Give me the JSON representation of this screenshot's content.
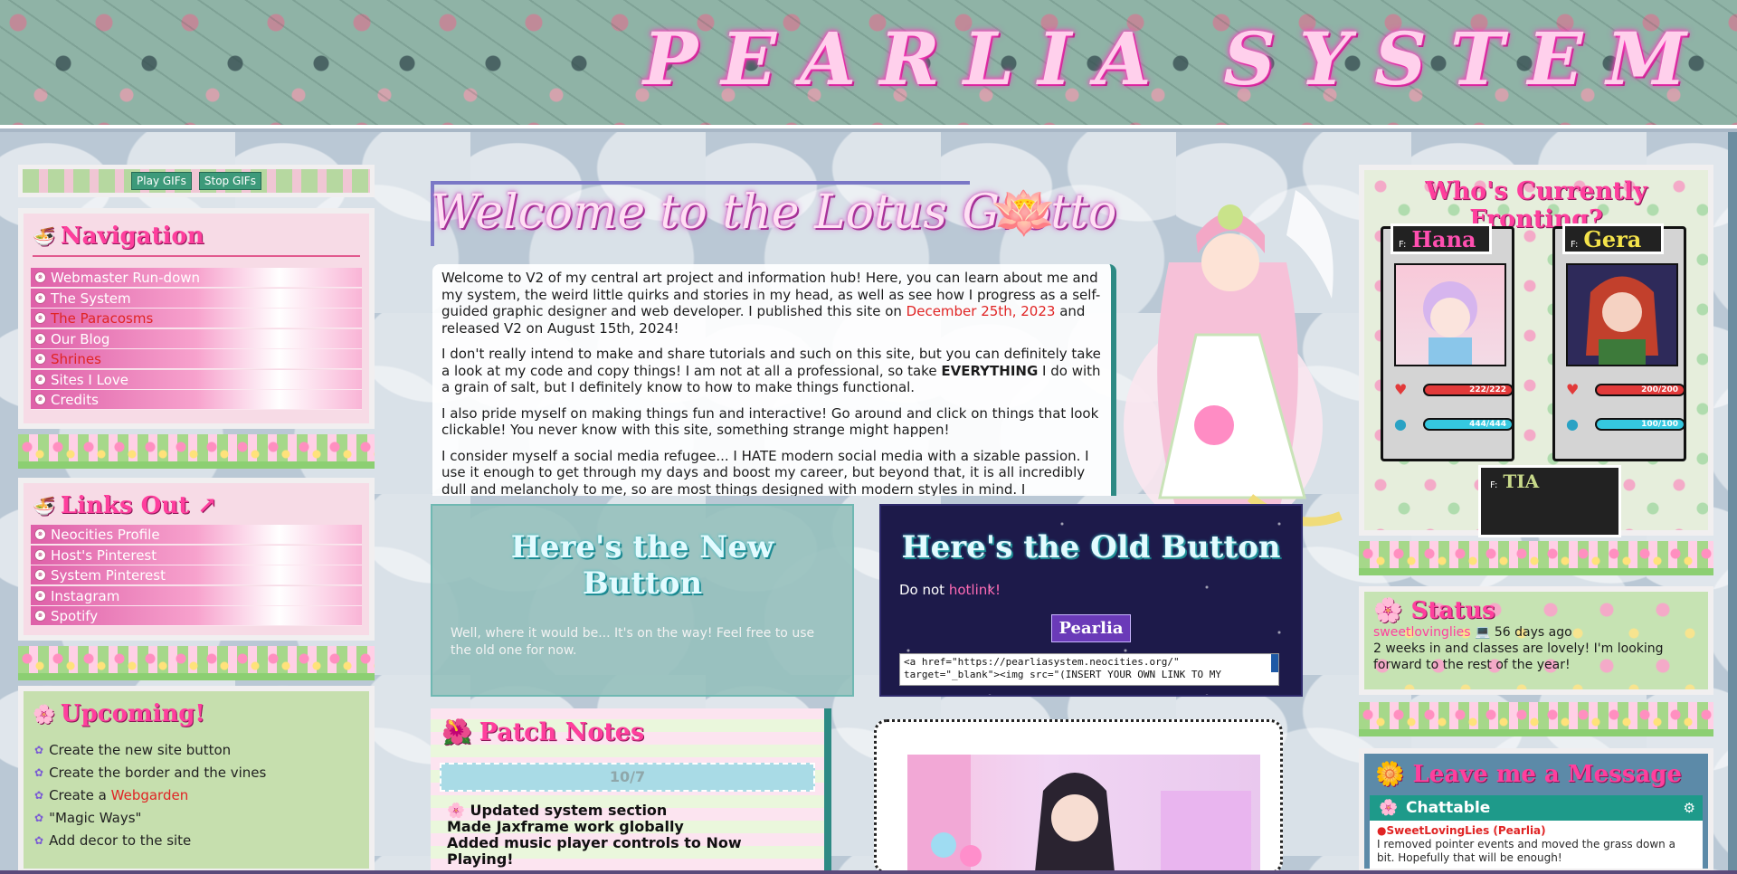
{
  "header": {
    "title": "PEARLIA SYSTEM"
  },
  "gif_controls": {
    "play": "Play GIFs",
    "stop": "Stop GIFs"
  },
  "navigation": {
    "title": "Navigation",
    "items": [
      {
        "label": "Webmaster Run-down",
        "style": "normal"
      },
      {
        "label": "The System",
        "style": "normal"
      },
      {
        "label": "The Paracosms",
        "style": "red"
      },
      {
        "label": "Our Blog",
        "style": "normal"
      },
      {
        "label": "Shrines",
        "style": "red"
      },
      {
        "label": "Sites I Love",
        "style": "normal"
      },
      {
        "label": "Credits",
        "style": "normal"
      }
    ]
  },
  "links_out": {
    "title": "Links Out ↗",
    "items": [
      {
        "label": "Neocities Profile"
      },
      {
        "label": "Host's Pinterest"
      },
      {
        "label": "System Pinterest"
      },
      {
        "label": "Instagram"
      },
      {
        "label": "Spotify"
      }
    ]
  },
  "upcoming": {
    "title": "Upcoming!",
    "items": [
      {
        "before": "Create the new site button",
        "link": "",
        "after": ""
      },
      {
        "before": "Create the border and the vines",
        "link": "",
        "after": ""
      },
      {
        "before": "Create a ",
        "link": "Webgarden",
        "after": ""
      },
      {
        "before": "\"Magic Ways\"",
        "link": "",
        "after": ""
      },
      {
        "before": "Add decor to the site",
        "link": "",
        "after": ""
      }
    ]
  },
  "welcome": {
    "title": "Welcome to the Lotus Grotto",
    "p1_a": "Welcome to V2 of my central art project and information hub! Here, you can learn about me and my system, the weird little quirks and stories in my head, as well as see how I progress as a self-guided graphic designer and web developer. I published this site on ",
    "p1_date": "December 25th, 2023",
    "p1_b": " and released V2 on August 15th, 2024!",
    "p2_a": "I don't really intend to make and share tutorials and such on this site, but you can definitely take a look at my code and copy things! I am not at all a professional, so take ",
    "p2_caps": "EVERYTHING",
    "p2_b": " I do with a grain of salt, but I definitely know to how to make things functional.",
    "p3": "I also pride myself on making things fun and interactive! Go around and click on things that look clickable! You never know with this site, something strange might happen!",
    "p4": "I consider myself a social media refugee... I HATE modern social media with a sizable passion. I use it enough to get through my days and boost my career, but beyond that, it is all incredibly dull and melancholy to me, so are most things designed with modern styles in mind. I"
  },
  "new_button": {
    "title": "Here's the New Button",
    "text": "Well, where it would be... It's on the way! Feel free to use the old one for now."
  },
  "old_button": {
    "title": "Here's the Old Button",
    "hotlink_prefix": "Do not ",
    "hotlink_link": "hotlink!",
    "badge": "Pearlia",
    "code": "<a href=\"https://pearliasystem.neocities.org/\" target=\"_blank\"><img src=\"(INSERT YOUR OWN LINK TO MY"
  },
  "patch_notes": {
    "title": "Patch Notes",
    "date": "10/7",
    "line1": "Updated system section",
    "line2": "Made Jaxframe work globally",
    "line3": "Added music player controls to Now Playing!"
  },
  "fronting": {
    "title": "Who's Currently Fronting?",
    "cards": [
      {
        "prefix": "F:",
        "name": "Hana",
        "hp": "222/222",
        "mp": "444/444",
        "color": "#ff4fb0"
      },
      {
        "prefix": "F:",
        "name": "Gera",
        "hp": "200/200",
        "mp": "100/100",
        "color": "#f4e34a"
      }
    ],
    "third": {
      "prefix": "F:",
      "name": "TIA"
    }
  },
  "status": {
    "title": "Status",
    "user": "sweetlovinglies",
    "when": "💻 56 days ago",
    "text": "2 weeks in and classes are lovely! I'm looking forward to the rest of the year!"
  },
  "message": {
    "title": "Leave me a Message",
    "chat_title": "Chattable",
    "entry_user": "●SweetLovingLies (Pearlia)",
    "entry_text": "I removed pointer events and moved the grass down a bit. Hopefully that will be enough!"
  }
}
